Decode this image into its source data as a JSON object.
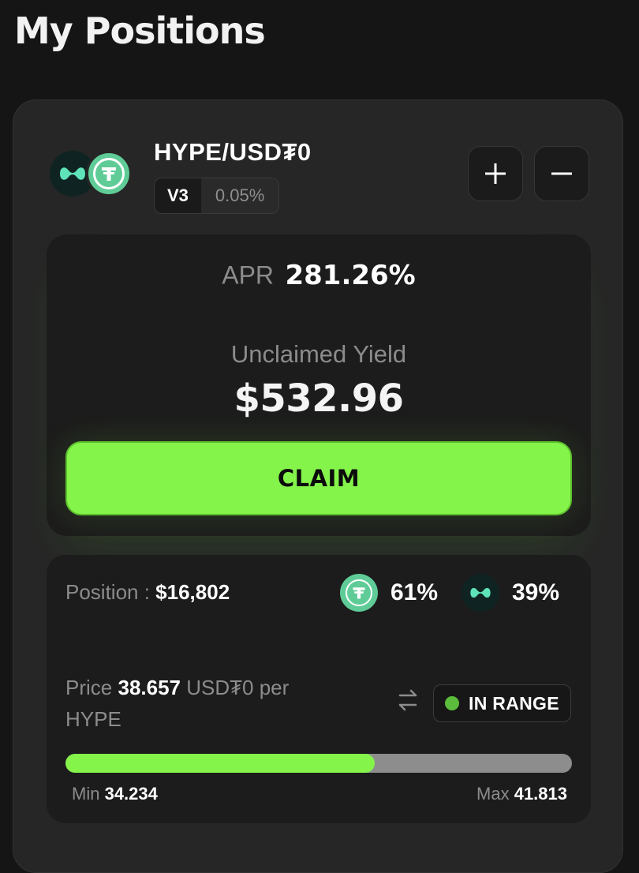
{
  "page": {
    "title": "My Positions"
  },
  "position": {
    "pair": "HYPE/USD₮0",
    "version": "V3",
    "fee": "0.05%",
    "tokens": [
      {
        "symbol": "HYPE",
        "icon": "hype-logo-icon",
        "color": "#5fe3b8"
      },
      {
        "symbol": "USD₮0",
        "icon": "usdt0-logo-icon",
        "color": "#5fcc97"
      }
    ],
    "actions": {
      "add": "+",
      "remove": "−"
    }
  },
  "yield": {
    "apr_label": "APR",
    "apr_value": "281.26%",
    "unclaimed_label": "Unclaimed Yield",
    "unclaimed_value": "$532.96",
    "claim_label": "CLAIM"
  },
  "details": {
    "position_label": "Position : ",
    "position_value": "$16,802",
    "usdt_pct": "61%",
    "hype_pct": "39%",
    "price_label": "Price",
    "price_value": "38.657",
    "price_unit": "USD₮0 per HYPE",
    "range_status": "IN RANGE",
    "range_fill_percent": 61,
    "min_label": "Min",
    "min_value": "34.234",
    "max_label": "Max",
    "max_value": "41.813"
  },
  "colors": {
    "accent_green": "#84f44a",
    "status_green": "#5bbd3b",
    "usdt_green": "#5fcc97",
    "hype_mint": "#5fe3b8",
    "background": "#151515",
    "card": "#262626"
  }
}
